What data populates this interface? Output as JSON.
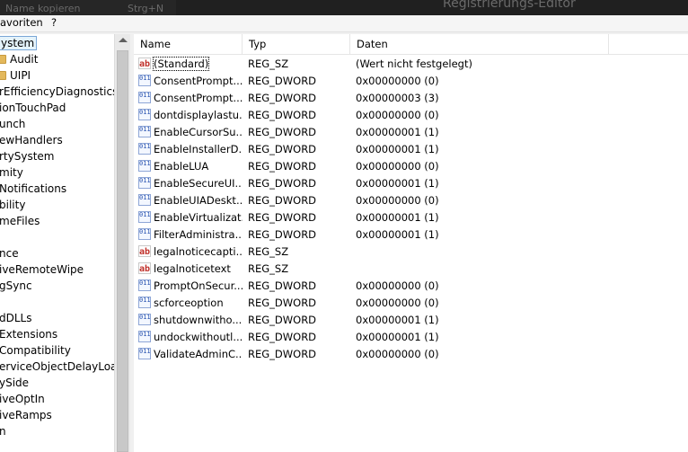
{
  "window": {
    "title": "Registrierungs-Editor",
    "faded_menu": [
      "Name kopieren",
      "Strg+N"
    ]
  },
  "menubar": {
    "items": [
      "avoriten",
      "?"
    ]
  },
  "tree": {
    "items": [
      {
        "label": "ystem",
        "selected": true,
        "folder": false,
        "indent": 0
      },
      {
        "label": "Audit",
        "folder": true,
        "indent": 1
      },
      {
        "label": "UIPI",
        "folder": true,
        "indent": 1
      },
      {
        "label": "rEfficiencyDiagnostics",
        "folder": false,
        "indent": 0
      },
      {
        "label": "ionTouchPad",
        "folder": false,
        "indent": 0
      },
      {
        "label": "unch",
        "folder": false,
        "indent": 0
      },
      {
        "label": "ewHandlers",
        "folder": false,
        "indent": 0
      },
      {
        "label": "rtySystem",
        "folder": false,
        "indent": 0
      },
      {
        "label": "mity",
        "folder": false,
        "indent": 0
      },
      {
        "label": "Notifications",
        "folder": false,
        "indent": 0
      },
      {
        "label": "bility",
        "folder": false,
        "indent": 0
      },
      {
        "label": "meFiles",
        "folder": false,
        "indent": 0
      },
      {
        "label": "",
        "folder": false,
        "indent": 0
      },
      {
        "label": "nce",
        "folder": false,
        "indent": 0
      },
      {
        "label": "iveRemoteWipe",
        "folder": false,
        "indent": 0
      },
      {
        "label": "gSync",
        "folder": false,
        "indent": 0
      },
      {
        "label": "",
        "folder": false,
        "indent": 0
      },
      {
        "label": "dDLLs",
        "folder": false,
        "indent": 0
      },
      {
        "label": "Extensions",
        "folder": false,
        "indent": 0
      },
      {
        "label": "Compatibility",
        "folder": false,
        "indent": 0
      },
      {
        "label": "erviceObjectDelayLoad",
        "folder": false,
        "indent": 0
      },
      {
        "label": "ySide",
        "folder": false,
        "indent": 0
      },
      {
        "label": "iveOptIn",
        "folder": false,
        "indent": 0
      },
      {
        "label": "iveRamps",
        "folder": false,
        "indent": 0
      },
      {
        "label": "n",
        "folder": false,
        "indent": 0
      }
    ]
  },
  "list": {
    "columns": {
      "name": "Name",
      "type": "Typ",
      "data": "Daten"
    },
    "rows": [
      {
        "icon": "sz",
        "name": "(Standard)",
        "type": "REG_SZ",
        "data": "(Wert nicht festgelegt)",
        "selected": true
      },
      {
        "icon": "dword",
        "name": "ConsentPrompt...",
        "type": "REG_DWORD",
        "data": "0x00000000 (0)"
      },
      {
        "icon": "dword",
        "name": "ConsentPrompt...",
        "type": "REG_DWORD",
        "data": "0x00000003 (3)"
      },
      {
        "icon": "dword",
        "name": "dontdisplaylastu...",
        "type": "REG_DWORD",
        "data": "0x00000000 (0)"
      },
      {
        "icon": "dword",
        "name": "EnableCursorSu...",
        "type": "REG_DWORD",
        "data": "0x00000001 (1)"
      },
      {
        "icon": "dword",
        "name": "EnableInstallerD...",
        "type": "REG_DWORD",
        "data": "0x00000001 (1)"
      },
      {
        "icon": "dword",
        "name": "EnableLUA",
        "type": "REG_DWORD",
        "data": "0x00000000 (0)"
      },
      {
        "icon": "dword",
        "name": "EnableSecureUI...",
        "type": "REG_DWORD",
        "data": "0x00000001 (1)"
      },
      {
        "icon": "dword",
        "name": "EnableUIADeskt...",
        "type": "REG_DWORD",
        "data": "0x00000000 (0)"
      },
      {
        "icon": "dword",
        "name": "EnableVirtualizat...",
        "type": "REG_DWORD",
        "data": "0x00000001 (1)"
      },
      {
        "icon": "dword",
        "name": "FilterAdministra...",
        "type": "REG_DWORD",
        "data": "0x00000001 (1)"
      },
      {
        "icon": "sz",
        "name": "legalnoticecapti...",
        "type": "REG_SZ",
        "data": ""
      },
      {
        "icon": "sz",
        "name": "legalnoticetext",
        "type": "REG_SZ",
        "data": ""
      },
      {
        "icon": "dword",
        "name": "PromptOnSecur...",
        "type": "REG_DWORD",
        "data": "0x00000000 (0)"
      },
      {
        "icon": "dword",
        "name": "scforceoption",
        "type": "REG_DWORD",
        "data": "0x00000000 (0)"
      },
      {
        "icon": "dword",
        "name": "shutdownwitho...",
        "type": "REG_DWORD",
        "data": "0x00000001 (1)"
      },
      {
        "icon": "dword",
        "name": "undockwithoutl...",
        "type": "REG_DWORD",
        "data": "0x00000001 (1)"
      },
      {
        "icon": "dword",
        "name": "ValidateAdminC...",
        "type": "REG_DWORD",
        "data": "0x00000000 (0)"
      }
    ]
  },
  "icons": {
    "sz": "ab",
    "dword": "011"
  },
  "colors": {
    "sz_icon": "#c0302a",
    "dword_icon": "#2a54b0",
    "selection_outline": "#7aa7d6"
  }
}
